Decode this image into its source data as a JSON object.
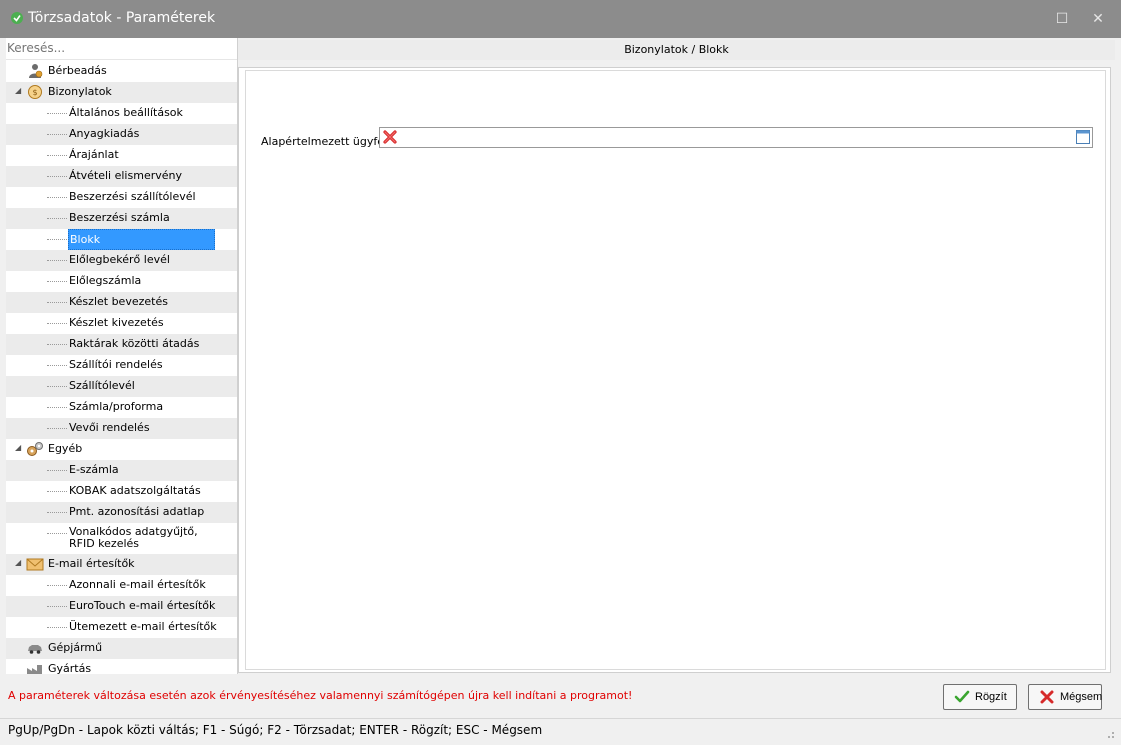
{
  "window": {
    "title": "Törzsadatok - Paraméterek",
    "maximize_glyph": "☐",
    "close_glyph": "✕"
  },
  "sidebar": {
    "search_placeholder": "Keresés...",
    "tree": [
      {
        "label": "Bérbeadás",
        "level": 0,
        "icon": "person-coin-icon"
      },
      {
        "label": "Bizonylatok",
        "level": 0,
        "icon": "coin-icon",
        "expanded": true
      },
      {
        "label": "Általános beállítások",
        "level": 1
      },
      {
        "label": "Anyagkiadás",
        "level": 1
      },
      {
        "label": "Árajánlat",
        "level": 1
      },
      {
        "label": "Átvételi elismervény",
        "level": 1
      },
      {
        "label": "Beszerzési szállítólevél",
        "level": 1
      },
      {
        "label": "Beszerzési számla",
        "level": 1
      },
      {
        "label": "Blokk",
        "level": 1,
        "selected": true
      },
      {
        "label": "Előlegbekérő levél",
        "level": 1
      },
      {
        "label": "Előlegszámla",
        "level": 1
      },
      {
        "label": "Készlet bevezetés",
        "level": 1
      },
      {
        "label": "Készlet kivezetés",
        "level": 1
      },
      {
        "label": "Raktárak közötti átadás",
        "level": 1
      },
      {
        "label": "Szállítói rendelés",
        "level": 1
      },
      {
        "label": "Szállítólevél",
        "level": 1
      },
      {
        "label": "Számla/proforma",
        "level": 1
      },
      {
        "label": "Vevői rendelés",
        "level": 1
      },
      {
        "label": "Egyéb",
        "level": 0,
        "icon": "gears-icon",
        "expanded": true
      },
      {
        "label": "E-számla",
        "level": 1
      },
      {
        "label": "KOBAK adatszolgáltatás",
        "level": 1
      },
      {
        "label": "Pmt. azonosítási adatlap",
        "level": 1
      },
      {
        "label": "Vonalkódos adatgyűjtő, RFID kezelés",
        "level": 1,
        "tall": true
      },
      {
        "label": "E-mail értesítők",
        "level": 0,
        "icon": "envelope-icon",
        "expanded": true
      },
      {
        "label": "Azonnali e-mail értesítők",
        "level": 1
      },
      {
        "label": "EuroTouch e-mail értesítők",
        "level": 1
      },
      {
        "label": "Ütemezett e-mail értesítők",
        "level": 1
      },
      {
        "label": "Gépjármű",
        "level": 0,
        "icon": "car-icon"
      },
      {
        "label": "Gyártás",
        "level": 0,
        "icon": "factory-icon"
      }
    ]
  },
  "main": {
    "breadcrumb": "Bizonylatok / Blokk",
    "field_label": "Alapértelmezett ügyfél:",
    "field_value": ""
  },
  "footer": {
    "warning": "A paraméterek változása esetén azok érvényesítéséhez valamennyi számítógépen újra kell indítani a programot!",
    "save_label": "Rögzít",
    "cancel_label": "Mégsem",
    "status": "PgUp/PgDn - Lapok közti váltás; F1 - Súgó; F2 - Törzsadat; ENTER - Rögzít; ESC - Mégsem"
  },
  "colors": {
    "selection": "#3399ff",
    "warning": "#e00000",
    "titlebar": "#8c8c8c"
  }
}
